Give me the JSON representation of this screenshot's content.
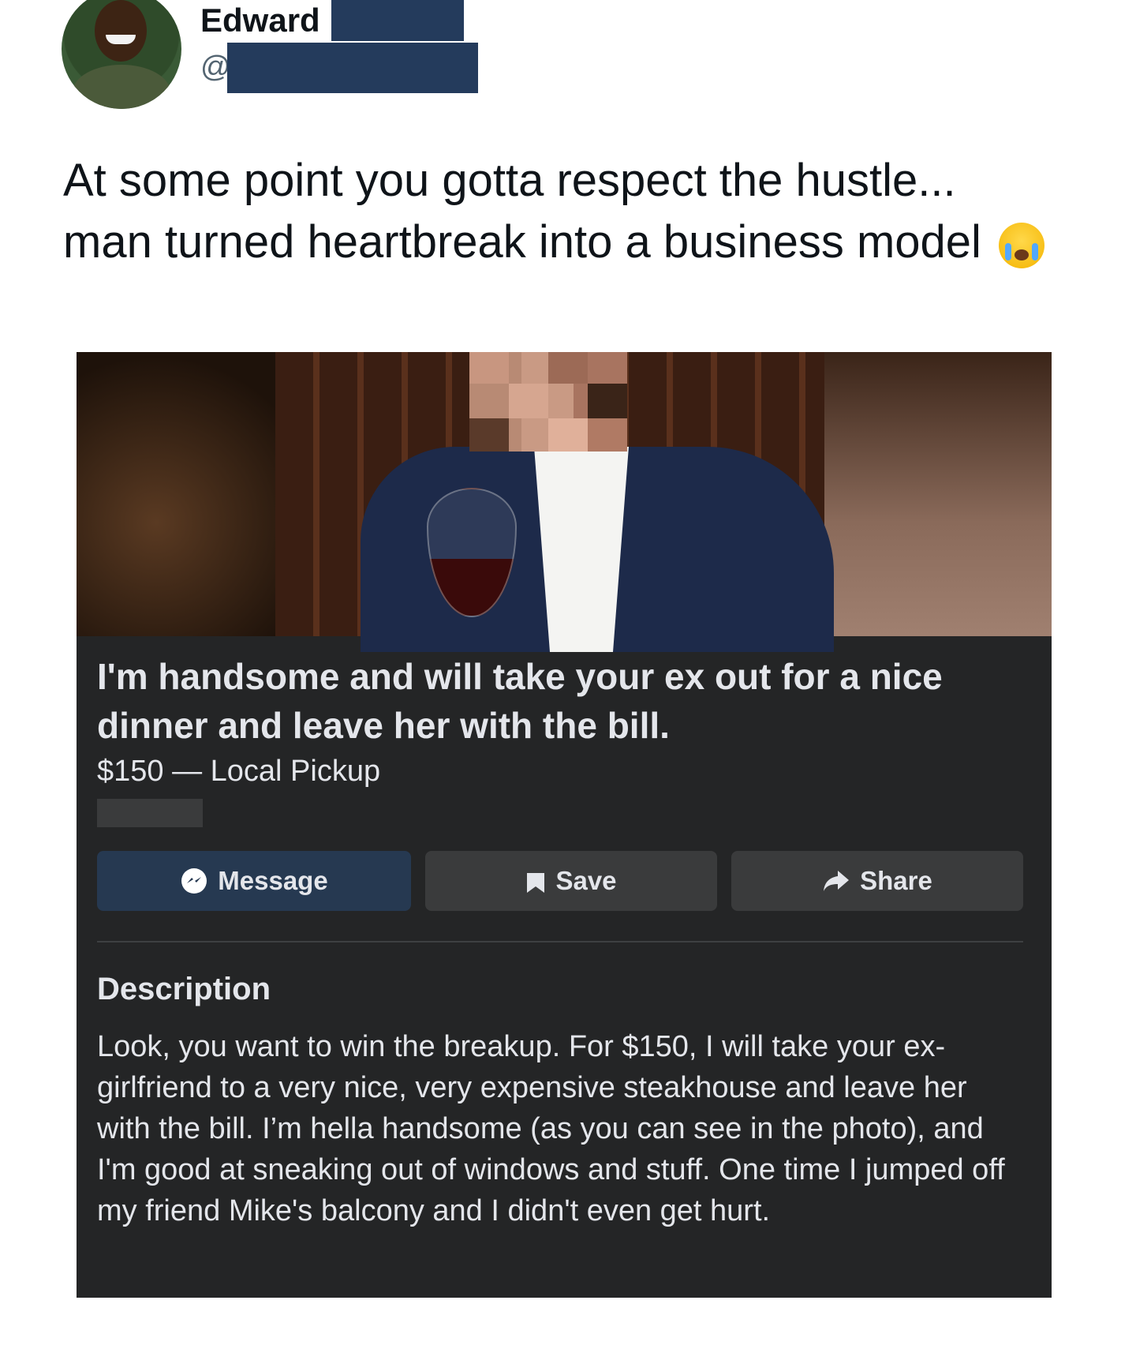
{
  "tweet": {
    "display_name": "Edward",
    "handle_prefix": "@",
    "text_line1": "At some point you gotta respect the hustle...",
    "text_line2": "man turned heartbreak into a business model",
    "emoji": "loudly-crying-face"
  },
  "listing": {
    "title": "I'm handsome and will take your ex out for a nice dinner and leave her with the bill.",
    "price_line": "$150 — Local Pickup",
    "buttons": {
      "message": "Message",
      "save": "Save",
      "share": "Share"
    },
    "description_heading": "Description",
    "description_body": "Look, you want to win the breakup. For $150, I will take your ex-girlfriend to a very nice, very expensive steakhouse and leave her with the bill. I’m hella handsome (as you can see in the photo), and I'm good at sneaking out of windows and stuff. One time I jumped off my friend Mike's balcony and I didn't even get hurt."
  },
  "colors": {
    "redaction": "#243b5c",
    "card_bg": "#242526",
    "message_button": "#263951",
    "secondary_button": "#3a3b3c"
  }
}
